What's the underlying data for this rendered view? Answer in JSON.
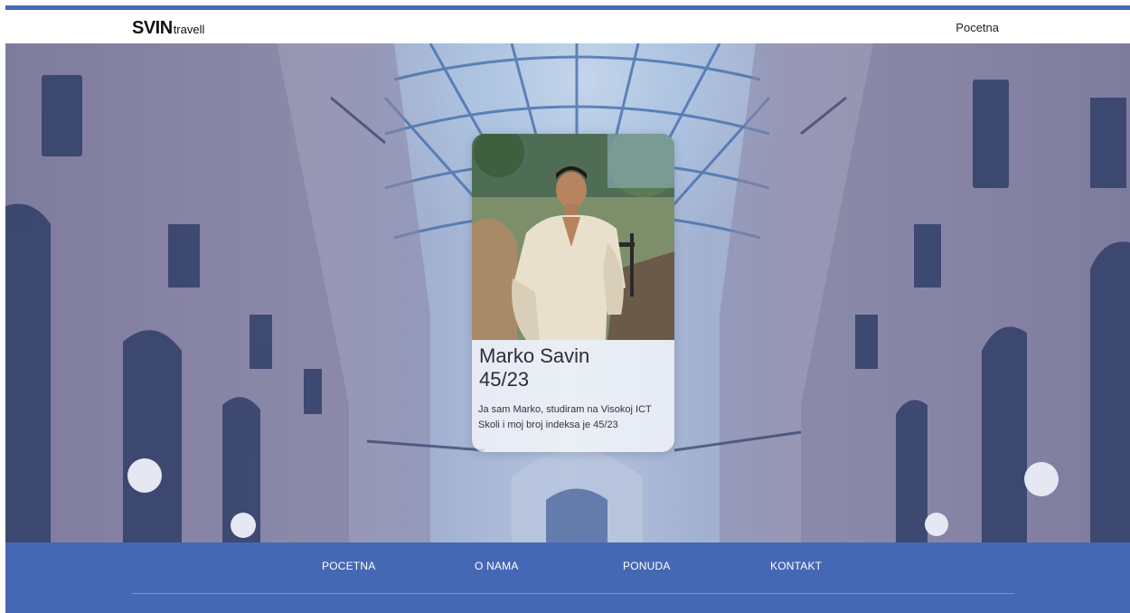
{
  "header": {
    "logo": {
      "mark": "SVIN",
      "sub": "travell"
    },
    "nav": [
      {
        "label": "Pocetna"
      }
    ]
  },
  "profile": {
    "name": "Marko Savin",
    "index": "45/23",
    "bio": "Ja sam Marko, studiram na Visokoj ICT Skoli i moj broj indeksa je 45/23"
  },
  "footer": {
    "nav": [
      {
        "label": "POCETNA"
      },
      {
        "label": "O NAMA"
      },
      {
        "label": "PONUDA"
      },
      {
        "label": "KONTAKT"
      }
    ]
  },
  "colors": {
    "brand_blue": "#4668b4",
    "card_bg": "#ffffff",
    "text_dark": "#2d2d3a"
  },
  "icons": {
    "logo_cross": "cross-icon"
  }
}
